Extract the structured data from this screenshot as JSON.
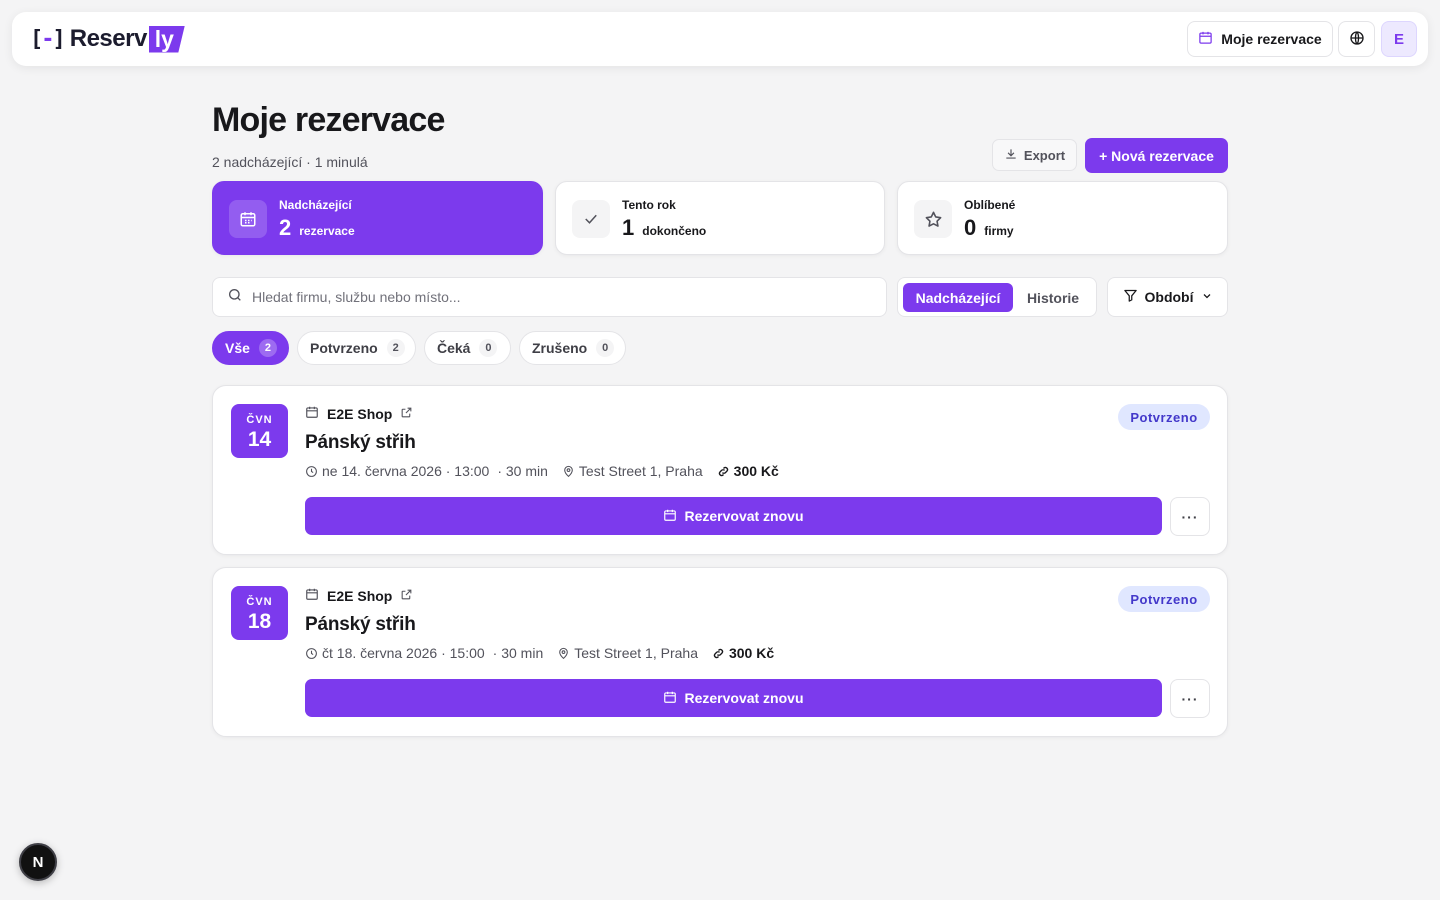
{
  "brand": {
    "bracket_left": "[",
    "bracket_dash": "-",
    "bracket_right": "]",
    "name": "Reserv",
    "suffix": "ly",
    "accent": "#7c3aed"
  },
  "nav": {
    "reservations_label": "Moje rezervace",
    "reservations_icon": "calendar-icon",
    "language_icon": "globe-icon",
    "avatar_initial": "E"
  },
  "header": {
    "title": "Moje rezervace",
    "subtitle": "2 nadcházející · 1 minulá",
    "export_label": "Export",
    "new_label": "+ Nová rezervace"
  },
  "stats": [
    {
      "label": "Nadcházející",
      "value": "2",
      "unit": "rezervace",
      "icon": "calendar-icon",
      "active": true
    },
    {
      "label": "Tento rok",
      "value": "1",
      "unit": "dokončeno",
      "icon": "check-icon",
      "active": false
    },
    {
      "label": "Oblíbené",
      "value": "0",
      "unit": "firmy",
      "icon": "star-icon",
      "active": false
    }
  ],
  "search": {
    "placeholder": "Hledat firmu, službu nebo místo...",
    "value": ""
  },
  "view_toggle": {
    "upcoming": "Nadcházející",
    "history": "Historie",
    "selected": "Nadcházející"
  },
  "period_filter": {
    "label": "Období",
    "icon": "filter-icon"
  },
  "status_chips": [
    {
      "label": "Vše",
      "count": "2",
      "active": true
    },
    {
      "label": "Potvrzeno",
      "count": "2",
      "active": false
    },
    {
      "label": "Čeká",
      "count": "0",
      "active": false
    },
    {
      "label": "Zrušeno",
      "count": "0",
      "active": false
    }
  ],
  "bookings": [
    {
      "month": "ČVN",
      "day": "14",
      "shop": "E2E Shop",
      "service": "Pánský střih",
      "datetime": "ne 14. června 2026 · 13:00",
      "duration": "· 30 min",
      "location": "Test Street 1, Praha",
      "price": "300 Kč",
      "status": "Potvrzeno",
      "rebook_label": "Rezervovat znovu",
      "more_label": "···"
    },
    {
      "month": "ČVN",
      "day": "18",
      "shop": "E2E Shop",
      "service": "Pánský střih",
      "datetime": "čt 18. června 2026 · 15:00",
      "duration": "· 30 min",
      "location": "Test Street 1, Praha",
      "price": "300 Kč",
      "status": "Potvrzeno",
      "rebook_label": "Rezervovat znovu",
      "more_label": "···"
    }
  ],
  "dev_indicator": {
    "label": "N"
  }
}
